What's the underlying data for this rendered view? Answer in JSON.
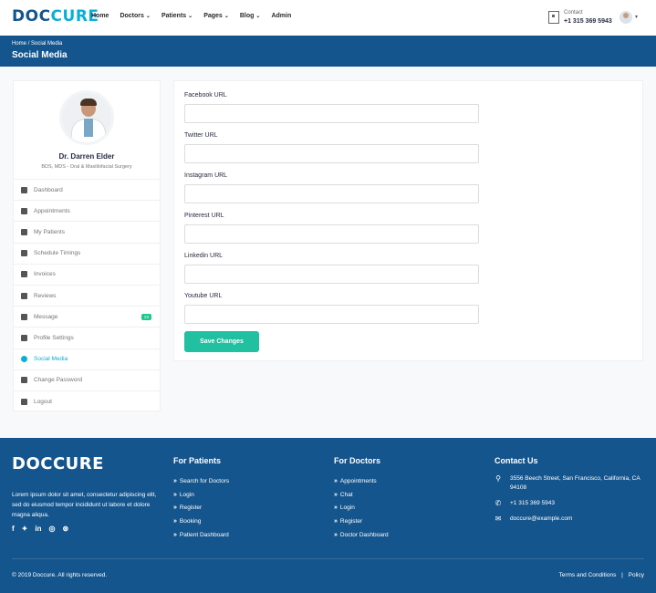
{
  "header": {
    "logo_a": "DOC",
    "logo_b": "CURE",
    "nav": [
      {
        "label": "Home",
        "chev": false
      },
      {
        "label": "Doctors",
        "chev": true
      },
      {
        "label": "Patients",
        "chev": true
      },
      {
        "label": "Pages",
        "chev": true
      },
      {
        "label": "Blog",
        "chev": true
      },
      {
        "label": "Admin",
        "chev": false
      }
    ],
    "contact_label": "Contact",
    "contact_phone": "+1 315 369 5943"
  },
  "breadcrumb": {
    "home": "Home",
    "sep": "/",
    "current": "Social Media",
    "title": "Social Media"
  },
  "profile": {
    "name": "Dr. Darren Elder",
    "desc": "BDS, MDS - Oral & Maxillofacial Surgery"
  },
  "menu": [
    {
      "label": "Dashboard",
      "icon": "columns-icon",
      "active": false
    },
    {
      "label": "Appointments",
      "icon": "calendar-check-icon",
      "active": false
    },
    {
      "label": "My Patients",
      "icon": "users-icon",
      "active": false
    },
    {
      "label": "Schedule Timings",
      "icon": "hourglass-icon",
      "active": false
    },
    {
      "label": "Invoices",
      "icon": "file-invoice-icon",
      "active": false
    },
    {
      "label": "Reviews",
      "icon": "star-icon",
      "active": false
    },
    {
      "label": "Message",
      "icon": "comments-icon",
      "active": false,
      "badge": "23"
    },
    {
      "label": "Profile Settings",
      "icon": "user-cog-icon",
      "active": false
    },
    {
      "label": "Social Media",
      "icon": "share-alt-icon",
      "active": true
    },
    {
      "label": "Change Password",
      "icon": "lock-icon",
      "active": false
    },
    {
      "label": "Logout",
      "icon": "sign-out-icon",
      "active": false
    }
  ],
  "form": {
    "fields": [
      {
        "label": "Facebook URL",
        "value": ""
      },
      {
        "label": "Twitter URL",
        "value": ""
      },
      {
        "label": "Instagram URL",
        "value": ""
      },
      {
        "label": "Pinterest URL",
        "value": ""
      },
      {
        "label": "Linkedin URL",
        "value": ""
      },
      {
        "label": "Youtube URL",
        "value": ""
      }
    ],
    "save_label": "Save Changes"
  },
  "footer": {
    "logo_a": "DOC",
    "logo_b": "CURE",
    "about": "Lorem ipsum dolor sit amet, consectetur adipiscing elit, sed do eiusmod tempor incididunt ut labore et dolore magna aliqua.",
    "social_icons": [
      "facebook-icon",
      "twitter-icon",
      "linkedin-icon",
      "instagram-icon",
      "dribbble-icon"
    ],
    "patients_title": "For Patients",
    "patients_links": [
      "Search for Doctors",
      "Login",
      "Register",
      "Booking",
      "Patient Dashboard"
    ],
    "doctors_title": "For Doctors",
    "doctors_links": [
      "Appointments",
      "Chat",
      "Login",
      "Register",
      "Doctor Dashboard"
    ],
    "contact_title": "Contact Us",
    "address": "3556 Beech Street, San Francisco, California, CA 94108",
    "phone": "+1 315 369 5943",
    "email": "doccure@example.com",
    "copyright": "© 2019 Doccure. All rights reserved.",
    "terms": "Terms and Conditions",
    "policy_sep": "|",
    "policy": "Policy"
  },
  "colors": {
    "brand_blue": "#15558d",
    "accent_cyan": "#09b0d6",
    "save_green": "#20c0a0"
  }
}
